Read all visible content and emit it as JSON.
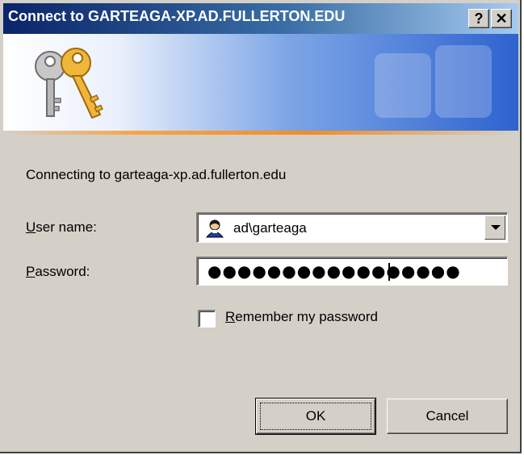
{
  "window": {
    "title": "Connect to GARTEAGA-XP.AD.FULLERTON.EDU",
    "help_label": "?",
    "close_label": "✕"
  },
  "banner": {
    "icon": "keys-icon",
    "watermark_icon": "keys-watermark-icon",
    "accent_color": "#f28c28"
  },
  "form": {
    "connecting_text": "Connecting to garteaga-xp.ad.fullerton.edu",
    "user": {
      "label_accel": "U",
      "label_rest": "ser name:",
      "value": "ad\\garteaga",
      "icon": "user-account-icon"
    },
    "password": {
      "label_accel": "P",
      "label_rest": "assword:",
      "masked_value": "●●●●●●●●●●●●●●●●●"
    },
    "remember": {
      "label_accel": "R",
      "label_rest": "emember my password",
      "checked": false
    }
  },
  "buttons": {
    "ok_label": "OK",
    "cancel_label": "Cancel"
  },
  "colors": {
    "titlebar_start": "#0a246a",
    "titlebar_end": "#a6caf0",
    "dialog_face": "#d4d0c8"
  }
}
